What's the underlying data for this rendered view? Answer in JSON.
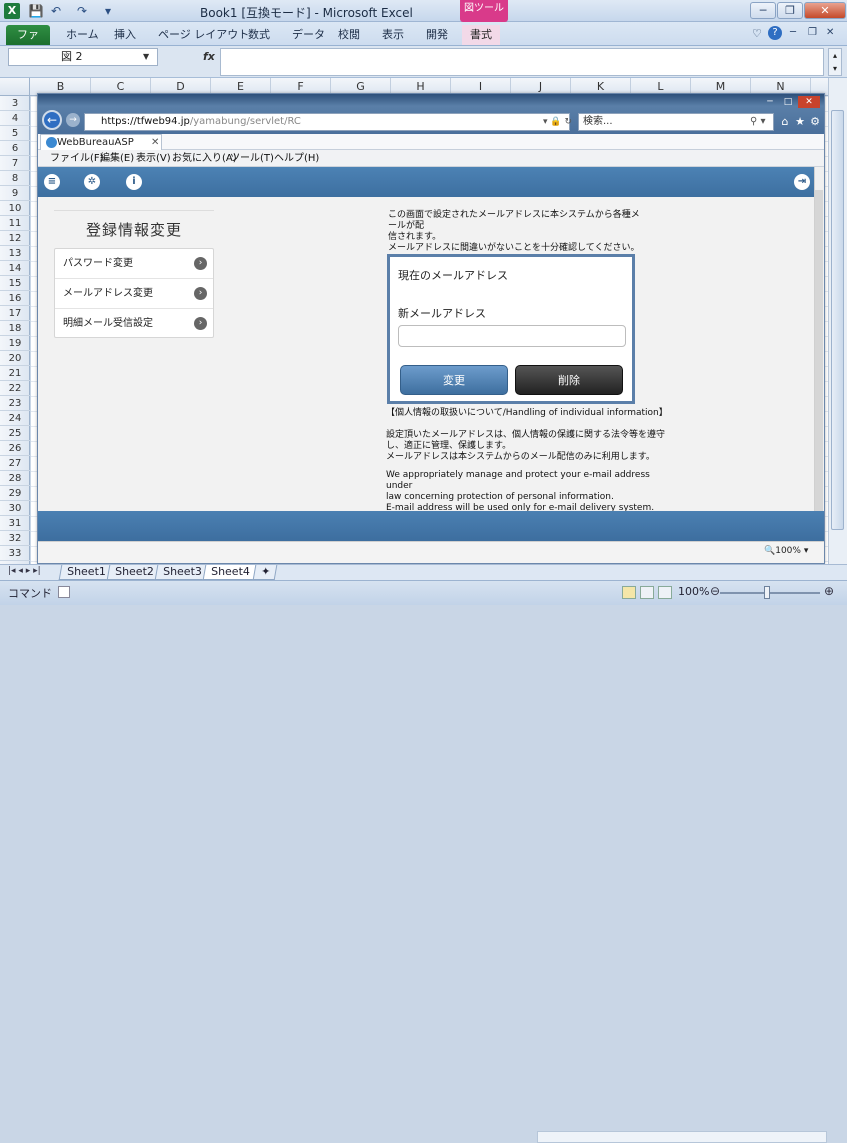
{
  "excel": {
    "logo": "X",
    "title": "Book1 [互換モード] - Microsoft Excel",
    "picture_tools": "図ツール",
    "tabs": [
      "ファイル",
      "ホーム",
      "挿入",
      "ページ レイアウト",
      "数式",
      "データ",
      "校閲",
      "表示",
      "開発",
      "書式"
    ],
    "name_box": "図 2",
    "fx": "fx",
    "columns": [
      "B",
      "C",
      "D",
      "E",
      "F",
      "G",
      "H",
      "I",
      "J",
      "K",
      "L",
      "M",
      "N"
    ],
    "rows": [
      "3",
      "4",
      "5",
      "6",
      "7",
      "8",
      "9",
      "10",
      "11",
      "12",
      "13",
      "14",
      "15",
      "16",
      "17",
      "18",
      "19",
      "20",
      "21",
      "22",
      "23",
      "24",
      "25",
      "26",
      "27",
      "28",
      "29",
      "30",
      "31",
      "32",
      "33"
    ],
    "sheets": [
      "Sheet1",
      "Sheet2",
      "Sheet3",
      "Sheet4"
    ],
    "status": "コマンド",
    "zoom": "100%"
  },
  "browser": {
    "url_host": "https://tfweb94.jp",
    "url_path": "/yamabung/servlet/RC",
    "search_placeholder": "検索...",
    "tab_title": "WebBureauASP",
    "menu": [
      "ファイル(F)",
      "編集(E)",
      "表示(V)",
      "お気に入り(A)",
      "ツール(T)",
      "ヘルプ(H)"
    ],
    "zoom": "100%"
  },
  "app": {
    "panel_title": "登録情報変更",
    "menu_items": [
      "パスワード変更",
      "メールアドレス変更",
      "明細メール受信設定"
    ],
    "notice_line1": "この画面で設定されたメールアドレスに本システムから各種メールが配",
    "notice_line2": "信されます。",
    "notice_line3": "メールアドレスに間違いがないことを十分確認してください。",
    "current_email_label": "現在のメールアドレス",
    "new_email_label": "新メールアドレス",
    "new_email_value": "",
    "change_button": "変更",
    "delete_button": "削除",
    "privacy_title": "【個人情報の取扱いについて/Handling of individual information】",
    "privacy_jp1": "設定頂いたメールアドレスは、個人情報の保護に関する法令等を遵守",
    "privacy_jp2": "し、適正に管理、保護します。",
    "privacy_jp3": "メールアドレスは本システムからのメール配信のみに利用します。",
    "privacy_en1": "We appropriately manage and protect your e-mail address under",
    "privacy_en2": "law concerning protection of personal information.",
    "privacy_en3": "E-mail address will be used only for e-mail delivery system."
  },
  "colors": {
    "toolbar_blue": "#4c82b4",
    "form_border": "#5b7fa9",
    "excel_green": "#1e7b3c",
    "picture_tools": "#d93a8a"
  }
}
